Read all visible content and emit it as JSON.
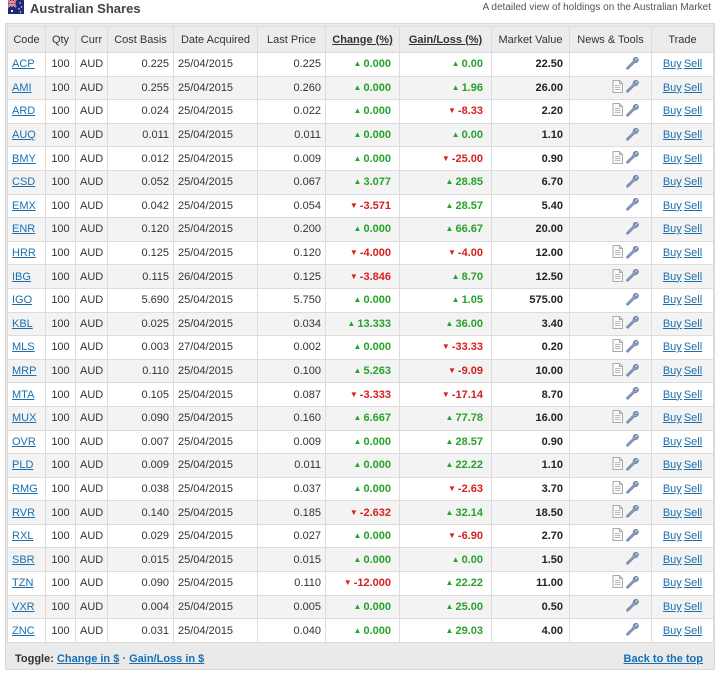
{
  "header": {
    "title": "Australian Shares",
    "subtitle": "A detailed view of holdings on the Australian Market"
  },
  "columns": [
    "Code",
    "Qty",
    "Curr",
    "Cost Basis",
    "Date Acquired",
    "Last Price",
    "Change (%)",
    "Gain/Loss (%)",
    "Market Value",
    "News & Tools",
    "Trade"
  ],
  "rows": [
    {
      "code": "ACP",
      "qty": "100",
      "curr": "AUD",
      "cost": "0.225",
      "date": "25/04/2015",
      "last": "0.225",
      "change": "0.000",
      "change_dir": "up",
      "gain": "0.00",
      "gain_dir": "up",
      "mv": "22.50",
      "news": false
    },
    {
      "code": "AMI",
      "qty": "100",
      "curr": "AUD",
      "cost": "0.255",
      "date": "25/04/2015",
      "last": "0.260",
      "change": "0.000",
      "change_dir": "up",
      "gain": "1.96",
      "gain_dir": "up",
      "mv": "26.00",
      "news": true
    },
    {
      "code": "ARD",
      "qty": "100",
      "curr": "AUD",
      "cost": "0.024",
      "date": "25/04/2015",
      "last": "0.022",
      "change": "0.000",
      "change_dir": "up",
      "gain": "-8.33",
      "gain_dir": "down",
      "mv": "2.20",
      "news": true
    },
    {
      "code": "AUQ",
      "qty": "100",
      "curr": "AUD",
      "cost": "0.011",
      "date": "25/04/2015",
      "last": "0.011",
      "change": "0.000",
      "change_dir": "up",
      "gain": "0.00",
      "gain_dir": "up",
      "mv": "1.10",
      "news": false
    },
    {
      "code": "BMY",
      "qty": "100",
      "curr": "AUD",
      "cost": "0.012",
      "date": "25/04/2015",
      "last": "0.009",
      "change": "0.000",
      "change_dir": "up",
      "gain": "-25.00",
      "gain_dir": "down",
      "mv": "0.90",
      "news": true
    },
    {
      "code": "CSD",
      "qty": "100",
      "curr": "AUD",
      "cost": "0.052",
      "date": "25/04/2015",
      "last": "0.067",
      "change": "3.077",
      "change_dir": "up",
      "gain": "28.85",
      "gain_dir": "up",
      "mv": "6.70",
      "news": false
    },
    {
      "code": "EMX",
      "qty": "100",
      "curr": "AUD",
      "cost": "0.042",
      "date": "25/04/2015",
      "last": "0.054",
      "change": "-3.571",
      "change_dir": "down",
      "gain": "28.57",
      "gain_dir": "up",
      "mv": "5.40",
      "news": false
    },
    {
      "code": "ENR",
      "qty": "100",
      "curr": "AUD",
      "cost": "0.120",
      "date": "25/04/2015",
      "last": "0.200",
      "change": "0.000",
      "change_dir": "up",
      "gain": "66.67",
      "gain_dir": "up",
      "mv": "20.00",
      "news": false
    },
    {
      "code": "HRR",
      "qty": "100",
      "curr": "AUD",
      "cost": "0.125",
      "date": "25/04/2015",
      "last": "0.120",
      "change": "-4.000",
      "change_dir": "down",
      "gain": "-4.00",
      "gain_dir": "down",
      "mv": "12.00",
      "news": true
    },
    {
      "code": "IBG",
      "qty": "100",
      "curr": "AUD",
      "cost": "0.115",
      "date": "26/04/2015",
      "last": "0.125",
      "change": "-3.846",
      "change_dir": "down",
      "gain": "8.70",
      "gain_dir": "up",
      "mv": "12.50",
      "news": true
    },
    {
      "code": "IGO",
      "qty": "100",
      "curr": "AUD",
      "cost": "5.690",
      "date": "25/04/2015",
      "last": "5.750",
      "change": "0.000",
      "change_dir": "up",
      "gain": "1.05",
      "gain_dir": "up",
      "mv": "575.00",
      "news": false
    },
    {
      "code": "KBL",
      "qty": "100",
      "curr": "AUD",
      "cost": "0.025",
      "date": "25/04/2015",
      "last": "0.034",
      "change": "13.333",
      "change_dir": "up",
      "gain": "36.00",
      "gain_dir": "up",
      "mv": "3.40",
      "news": true
    },
    {
      "code": "MLS",
      "qty": "100",
      "curr": "AUD",
      "cost": "0.003",
      "date": "27/04/2015",
      "last": "0.002",
      "change": "0.000",
      "change_dir": "up",
      "gain": "-33.33",
      "gain_dir": "down",
      "mv": "0.20",
      "news": true
    },
    {
      "code": "MRP",
      "qty": "100",
      "curr": "AUD",
      "cost": "0.110",
      "date": "25/04/2015",
      "last": "0.100",
      "change": "5.263",
      "change_dir": "up",
      "gain": "-9.09",
      "gain_dir": "down",
      "mv": "10.00",
      "news": true
    },
    {
      "code": "MTA",
      "qty": "100",
      "curr": "AUD",
      "cost": "0.105",
      "date": "25/04/2015",
      "last": "0.087",
      "change": "-3.333",
      "change_dir": "down",
      "gain": "-17.14",
      "gain_dir": "down",
      "mv": "8.70",
      "news": false
    },
    {
      "code": "MUX",
      "qty": "100",
      "curr": "AUD",
      "cost": "0.090",
      "date": "25/04/2015",
      "last": "0.160",
      "change": "6.667",
      "change_dir": "up",
      "gain": "77.78",
      "gain_dir": "up",
      "mv": "16.00",
      "news": true
    },
    {
      "code": "OVR",
      "qty": "100",
      "curr": "AUD",
      "cost": "0.007",
      "date": "25/04/2015",
      "last": "0.009",
      "change": "0.000",
      "change_dir": "up",
      "gain": "28.57",
      "gain_dir": "up",
      "mv": "0.90",
      "news": false
    },
    {
      "code": "PLD",
      "qty": "100",
      "curr": "AUD",
      "cost": "0.009",
      "date": "25/04/2015",
      "last": "0.011",
      "change": "0.000",
      "change_dir": "up",
      "gain": "22.22",
      "gain_dir": "up",
      "mv": "1.10",
      "news": true
    },
    {
      "code": "RMG",
      "qty": "100",
      "curr": "AUD",
      "cost": "0.038",
      "date": "25/04/2015",
      "last": "0.037",
      "change": "0.000",
      "change_dir": "up",
      "gain": "-2.63",
      "gain_dir": "down",
      "mv": "3.70",
      "news": true
    },
    {
      "code": "RVR",
      "qty": "100",
      "curr": "AUD",
      "cost": "0.140",
      "date": "25/04/2015",
      "last": "0.185",
      "change": "-2.632",
      "change_dir": "down",
      "gain": "32.14",
      "gain_dir": "up",
      "mv": "18.50",
      "news": true
    },
    {
      "code": "RXL",
      "qty": "100",
      "curr": "AUD",
      "cost": "0.029",
      "date": "25/04/2015",
      "last": "0.027",
      "change": "0.000",
      "change_dir": "up",
      "gain": "-6.90",
      "gain_dir": "down",
      "mv": "2.70",
      "news": true
    },
    {
      "code": "SBR",
      "qty": "100",
      "curr": "AUD",
      "cost": "0.015",
      "date": "25/04/2015",
      "last": "0.015",
      "change": "0.000",
      "change_dir": "up",
      "gain": "0.00",
      "gain_dir": "up",
      "mv": "1.50",
      "news": false
    },
    {
      "code": "TZN",
      "qty": "100",
      "curr": "AUD",
      "cost": "0.090",
      "date": "25/04/2015",
      "last": "0.110",
      "change": "-12.000",
      "change_dir": "down",
      "gain": "22.22",
      "gain_dir": "up",
      "mv": "11.00",
      "news": true
    },
    {
      "code": "VXR",
      "qty": "100",
      "curr": "AUD",
      "cost": "0.004",
      "date": "25/04/2015",
      "last": "0.005",
      "change": "0.000",
      "change_dir": "up",
      "gain": "25.00",
      "gain_dir": "up",
      "mv": "0.50",
      "news": false
    },
    {
      "code": "ZNC",
      "qty": "100",
      "curr": "AUD",
      "cost": "0.031",
      "date": "25/04/2015",
      "last": "0.040",
      "change": "0.000",
      "change_dir": "up",
      "gain": "29.03",
      "gain_dir": "up",
      "mv": "4.00",
      "news": false
    }
  ],
  "trade": {
    "buy": "Buy",
    "sell": "Sell"
  },
  "footer": {
    "toggle_label": "Toggle:",
    "link1": "Change in $",
    "separator": "·",
    "link2": "Gain/Loss in $",
    "back_to_top": "Back to the top"
  },
  "colors": {
    "up": "#27a22b",
    "down": "#d62020",
    "link": "#1a6fb0"
  }
}
